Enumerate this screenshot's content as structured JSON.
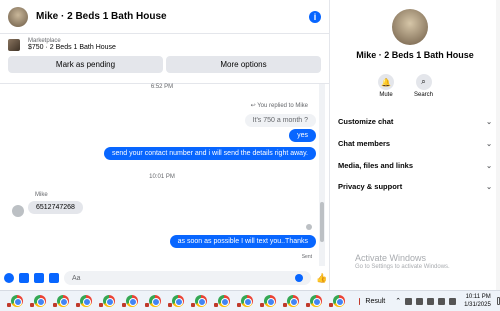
{
  "header": {
    "title": "Mike · 2 Beds 1 Bath House",
    "info_icon": "info-icon"
  },
  "marketplace": {
    "label": "Marketplace",
    "item": "$750 · 2 Beds 1 Bath House",
    "mark_pending": "Mark as pending",
    "more_options": "More options"
  },
  "messages": {
    "time1": "6:52 PM",
    "replied_note": "You replied to Mike",
    "quoted": "It's 750 a month ?",
    "yes": "yes",
    "contact": "send your contact number and i will send the details right away.",
    "time2": "10:01 PM",
    "sender": "Mike",
    "phone": "6512747268",
    "reply": "as soon as possible I will text you..Thanks",
    "status": "Sent"
  },
  "composer": {
    "placeholder": "Aa"
  },
  "side": {
    "title": "Mike · 2 Beds 1 Bath House",
    "mute": "Mute",
    "search": "Search",
    "sections": [
      "Customize chat",
      "Chat members",
      "Media, files and links",
      "Privacy & support"
    ]
  },
  "watermark": {
    "line1": "Activate Windows",
    "line2": "Go to Settings to activate Windows."
  },
  "taskbar": {
    "result": "Result",
    "time": "10:11 PM",
    "date": "1/31/2025",
    "app_count": 15
  },
  "colors": {
    "accent": "#0866ff",
    "bubble_gray": "#e4e6eb"
  }
}
